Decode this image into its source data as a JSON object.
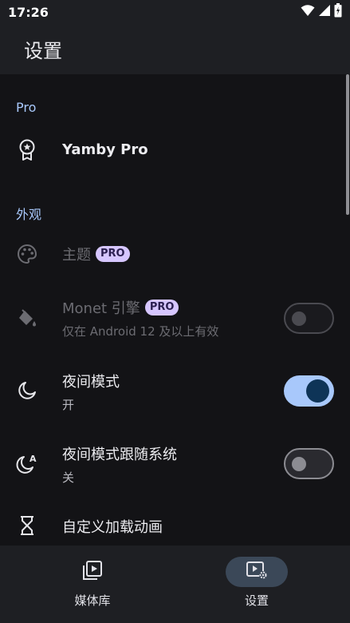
{
  "status_bar": {
    "time": "17:26"
  },
  "app_bar": {
    "title": "设置"
  },
  "sections": {
    "pro": {
      "header": "Pro"
    },
    "appearance": {
      "header": "外观"
    }
  },
  "rows": {
    "yamby_pro": {
      "title": "Yamby Pro",
      "icon": "award-badge-icon"
    },
    "theme": {
      "title": "主题",
      "badge": "PRO",
      "icon": "palette-icon",
      "enabled": false
    },
    "monet": {
      "title": "Monet 引擎",
      "badge": "PRO",
      "subtitle": "仅在 Android 12 及以上有效",
      "icon": "paint-bucket-icon",
      "enabled": false,
      "switch_on": false
    },
    "night_mode": {
      "title": "夜间模式",
      "subtitle": "开",
      "icon": "moon-icon",
      "switch_on": true
    },
    "night_follow_system": {
      "title": "夜间模式跟随系统",
      "subtitle": "关",
      "icon": "moon-auto-icon",
      "switch_on": false
    },
    "loading_animation": {
      "title": "自定义加载动画",
      "icon": "hourglass-icon"
    }
  },
  "bottom_nav": {
    "items": [
      {
        "label": "媒体库",
        "icon": "media-library-icon",
        "active": false
      },
      {
        "label": "设置",
        "icon": "settings-media-icon",
        "active": true
      }
    ]
  },
  "colors": {
    "accent": "#a8c8fb",
    "badge_bg": "#d6c6ff",
    "background": "#131316",
    "surface": "#1e1f23"
  }
}
